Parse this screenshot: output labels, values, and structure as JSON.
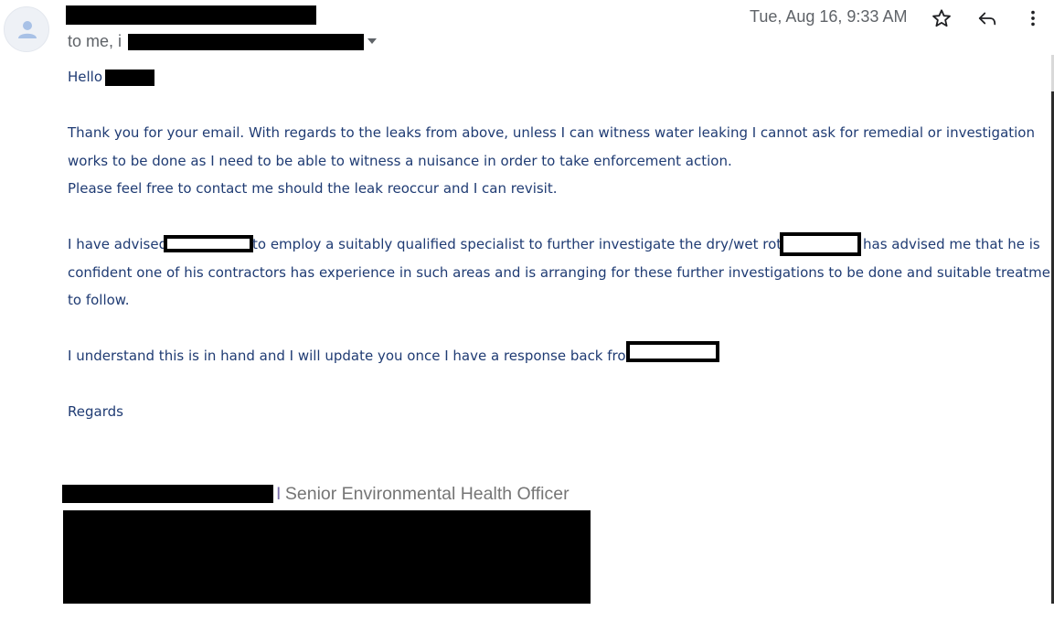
{
  "header": {
    "recipients_prefix": "to me, i",
    "date": "Tue, Aug 16, 9:33 AM",
    "icons": {
      "avatar": "person-icon",
      "star": "star-icon",
      "reply": "reply-icon",
      "more": "more-vert-icon",
      "details": "chevron-down-icon"
    }
  },
  "body": {
    "greeting": "Hello",
    "paragraph1_line1": "Thank you for your email. With regards to the leaks from above, unless I can witness water leaking I cannot ask for remedial or investigation",
    "paragraph1_line2": "works to be done as I need to be able to witness a nuisance in order to take enforcement action.",
    "paragraph1_line3": "Please feel free to contact me should the leak reoccur and I can revisit.",
    "paragraph2_line1_a": "I have advised",
    "paragraph2_line1_b": "to employ a suitably qualified specialist to further investigate the dry/wet rot.",
    "paragraph2_line1_c": "has advised me that he is",
    "paragraph2_line2": "confident one of his contractors has experience in such areas and is arranging for these further investigations to be done and suitable treatment",
    "paragraph2_line3": "to follow.",
    "paragraph3": "I understand this is in hand and I will update you once I have a response back from",
    "closing": "Regards"
  },
  "signature": {
    "separator": "I",
    "title": "Senior Environmental Health Officer"
  },
  "colors": {
    "body_text": "#1f3b73",
    "header_text": "#5f6368",
    "signature_text": "#757575",
    "redaction": "#000000"
  }
}
